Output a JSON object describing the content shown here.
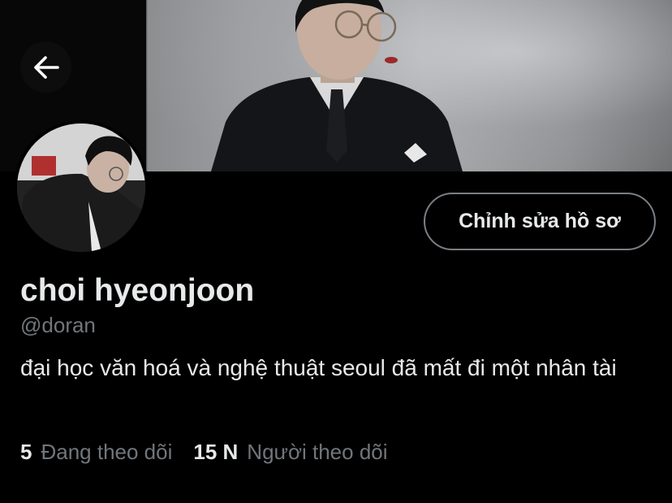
{
  "profile": {
    "display_name": "choi hyeonjoon",
    "handle": "@doran",
    "bio": "đại học văn hoá và nghệ thuật seoul đã mất đi một nhân tài",
    "edit_button_label": "Chỉnh sửa hồ sơ",
    "following_count": "5",
    "following_label": "Đang theo dõi",
    "followers_count": "15 N",
    "followers_label": "Người theo dõi"
  },
  "icons": {
    "back": "arrow-left-icon"
  },
  "colors": {
    "background": "#000000",
    "primary_text": "#e7e9ea",
    "secondary_text": "#71767b",
    "button_border": "#7a7f84"
  }
}
